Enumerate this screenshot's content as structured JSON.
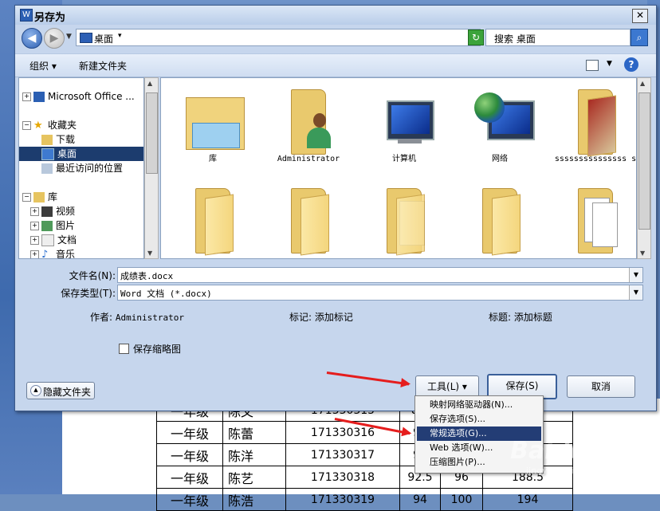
{
  "window": {
    "title": "另存为",
    "close_label": "✕"
  },
  "address": {
    "location": "桌面",
    "search_placeholder": "搜索 桌面"
  },
  "toolbar": {
    "organize_label": "组织 ▾",
    "new_folder_label": "新建文件夹",
    "help_label": "?"
  },
  "nav": {
    "items": [
      {
        "label": "Microsoft Office ..."
      },
      {
        "label": "收藏夹"
      },
      {
        "label": "下载"
      },
      {
        "label": "桌面"
      },
      {
        "label": "最近访问的位置"
      },
      {
        "label": "库"
      },
      {
        "label": "视频"
      },
      {
        "label": "图片"
      },
      {
        "label": "文档"
      },
      {
        "label": "音乐"
      }
    ]
  },
  "files": {
    "items": [
      {
        "label": "库"
      },
      {
        "label": "Administrator"
      },
      {
        "label": "计算机"
      },
      {
        "label": "网络"
      },
      {
        "label": "sssssssssssssss s"
      }
    ]
  },
  "form": {
    "filename_label": "文件名(N):",
    "filename_value": "成绩表.docx",
    "filetype_label": "保存类型(T):",
    "filetype_value": "Word 文档 (*.docx)",
    "author_label": "作者:",
    "author_value": "Administrator",
    "tags_label": "标记:",
    "tags_value": "添加标记",
    "title_label": "标题:",
    "title_value": "添加标题",
    "thumbnail_label": "保存缩略图"
  },
  "buttons": {
    "hide_folders": "隐藏文件夹",
    "tools": "工具(L)  ▾",
    "save": "保存(S)",
    "cancel": "取消"
  },
  "tools_menu": {
    "items": [
      {
        "label": "映射网络驱动器(N)..."
      },
      {
        "label": "保存选项(S)..."
      },
      {
        "label": "常规选项(G)..."
      },
      {
        "label": "Web 选项(W)..."
      },
      {
        "label": "压缩图片(P)..."
      }
    ],
    "highlighted_index": 2
  },
  "background_table": {
    "rows": [
      [
        "一年级",
        "陈文",
        "171330315",
        "89.",
        "",
        ""
      ],
      [
        "一年级",
        "陈蕾",
        "171330316",
        "92",
        "",
        ""
      ],
      [
        "一年级",
        "陈洋",
        "171330317",
        "92",
        "",
        ""
      ],
      [
        "一年级",
        "陈艺",
        "171330318",
        "92.5",
        "96",
        "188.5"
      ],
      [
        "一年级",
        "陈浩",
        "171330319",
        "94",
        "100",
        "194"
      ]
    ]
  },
  "watermark": {
    "brand": "Baidu 经验",
    "url": "jingyan.baidu.com"
  },
  "colors": {
    "accent": "#1c3c6e",
    "arrow": "#e51d1d",
    "menu_highlight": "#233d75"
  }
}
